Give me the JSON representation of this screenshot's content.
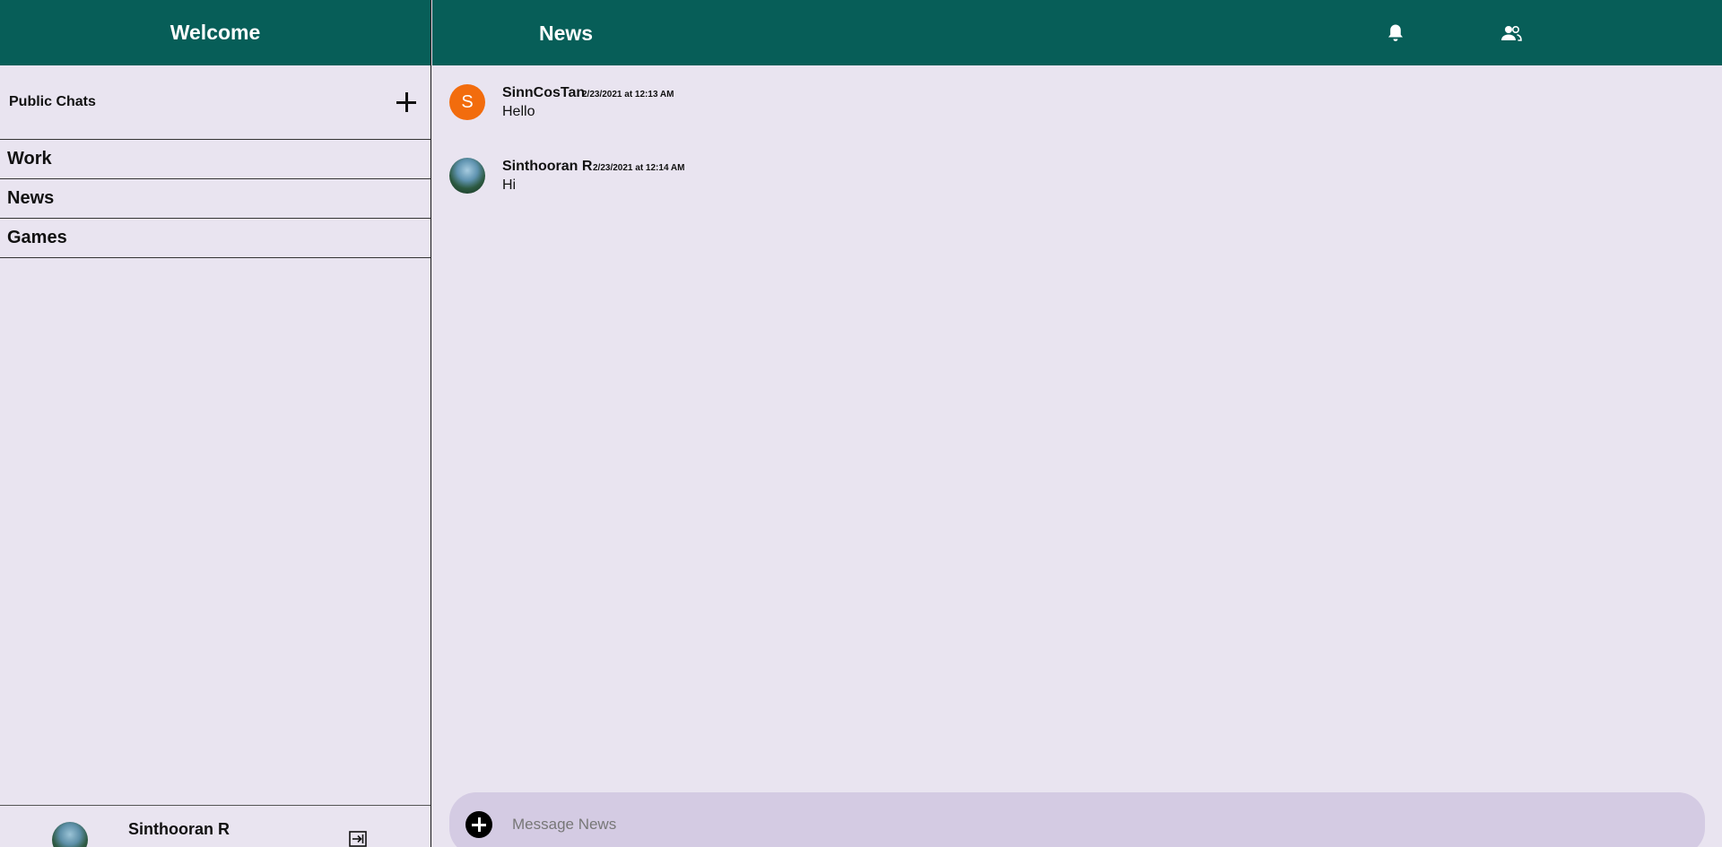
{
  "sidebar": {
    "title": "Welcome",
    "section_label": "Public Chats",
    "channels": [
      {
        "label": "Work"
      },
      {
        "label": "News"
      },
      {
        "label": "Games"
      }
    ],
    "user": {
      "name": "Sinthooran R"
    }
  },
  "header": {
    "channel_title": "News",
    "icons": [
      "bell-icon",
      "people-icon"
    ]
  },
  "messages": [
    {
      "author": "SinnCosTan",
      "timestamp": "2/23/2021 at 12:13 AM",
      "text": "Hello",
      "avatar_letter": "S",
      "avatar_color": "#f26c0d"
    },
    {
      "author": "Sinthooran R",
      "timestamp": "2/23/2021 at 12:14 AM",
      "text": "Hi",
      "avatar_letter": ""
    }
  ],
  "composer": {
    "placeholder": "Message News"
  },
  "colors": {
    "header": "#075e58",
    "background": "#e9e4f0",
    "composer": "#d4cbe3"
  }
}
